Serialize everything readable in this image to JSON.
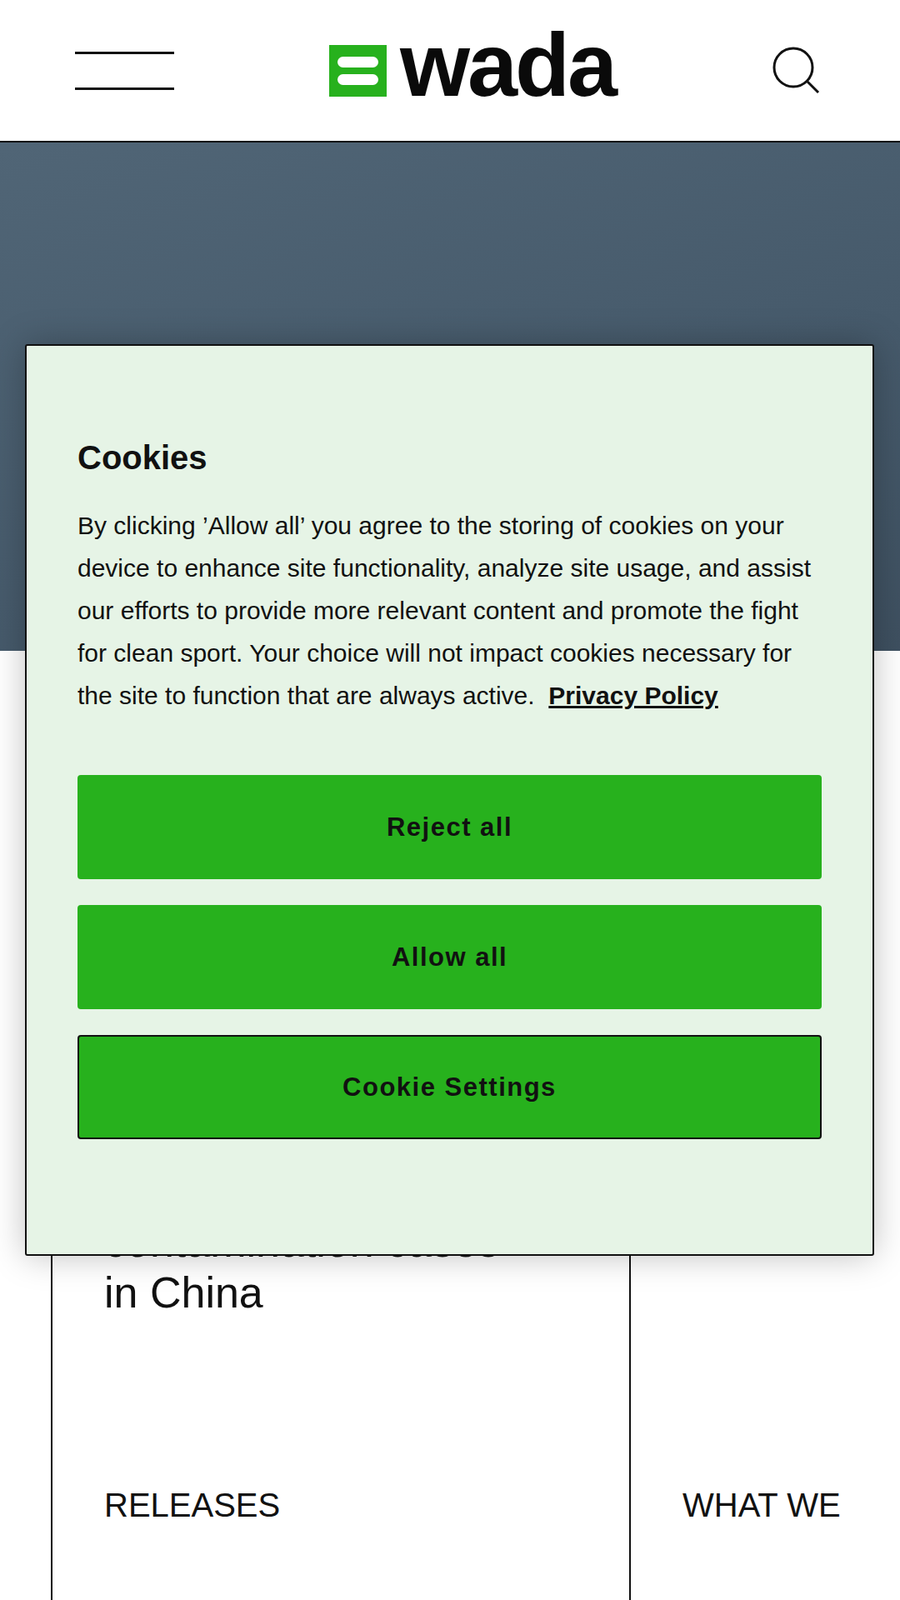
{
  "header": {
    "logo": "wada"
  },
  "cookie_dialog": {
    "title": "Cookies",
    "body": "By clicking ’Allow all’ you agree to the storing of cookies on your device to enhance site functionality, analyze site usage, and assist our efforts to provide more relevant content and promote the fight for clean sport. Your choice will not impact cookies necessary for the site to function that are always active.",
    "link": "Privacy Policy",
    "buttons": [
      {
        "label": "Reject all",
        "focused": false
      },
      {
        "label": "Allow all",
        "focused": false
      },
      {
        "label": "Cookie Settings",
        "focused": true
      }
    ]
  },
  "cards": [
    {
      "title_lines": [
        "contamination cases",
        "in China"
      ],
      "category": "RELEASES"
    },
    {
      "title_lines": [],
      "category": "WHAT WE"
    }
  ]
}
